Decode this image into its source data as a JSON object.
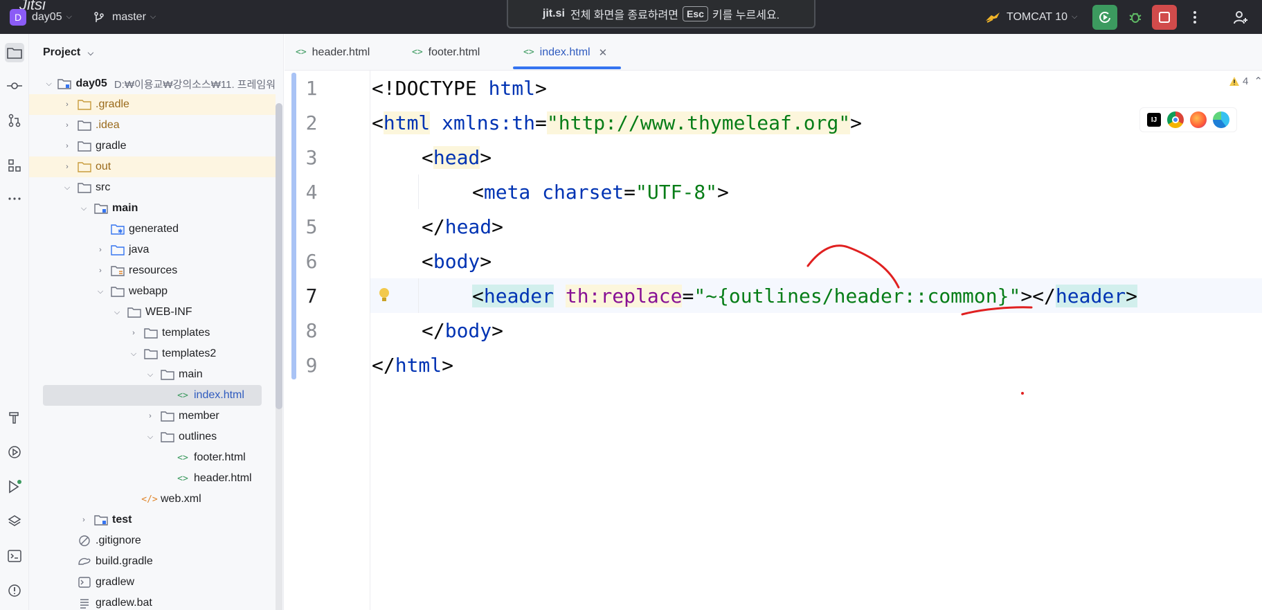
{
  "titlebar": {
    "app_logo_text": "Jitsi",
    "project_badge": "D",
    "project_name": "day05",
    "branch": "master",
    "banner_brand": "jit.si",
    "banner_text_before": "전체 화면을 종료하려면",
    "banner_key": "Esc",
    "banner_text_after": "키를 누르세요.",
    "run_config": "TOMCAT 10"
  },
  "project_panel": {
    "title": "Project",
    "root": {
      "name": "day05",
      "path": "D:₩이용교₩강의소스₩11. 프레임워"
    },
    "items": [
      {
        "label": ".gradle"
      },
      {
        "label": ".idea"
      },
      {
        "label": "gradle"
      },
      {
        "label": "out"
      },
      {
        "label": "src"
      },
      {
        "label": "main"
      },
      {
        "label": "generated"
      },
      {
        "label": "java"
      },
      {
        "label": "resources"
      },
      {
        "label": "webapp"
      },
      {
        "label": "WEB-INF"
      },
      {
        "label": "templates"
      },
      {
        "label": "templates2"
      },
      {
        "label": "main"
      },
      {
        "label": "index.html"
      },
      {
        "label": "member"
      },
      {
        "label": "outlines"
      },
      {
        "label": "footer.html"
      },
      {
        "label": "header.html"
      },
      {
        "label": "web.xml"
      },
      {
        "label": "test"
      },
      {
        "label": ".gitignore"
      },
      {
        "label": "build.gradle"
      },
      {
        "label": "gradlew"
      },
      {
        "label": "gradlew.bat"
      }
    ]
  },
  "tabs": [
    {
      "label": "header.html"
    },
    {
      "label": "footer.html"
    },
    {
      "label": "index.html"
    }
  ],
  "editor": {
    "line_numbers": [
      "1",
      "2",
      "3",
      "4",
      "5",
      "6",
      "7",
      "8",
      "9"
    ],
    "warning_count": "4",
    "lines": {
      "l1": {
        "a": "<!DOCTYPE ",
        "b": "html",
        "c": ">"
      },
      "l2": {
        "a": "<",
        "b": "html",
        "c": " ",
        "d": "xmlns:th",
        "e": "=",
        "f": "\"http://www.thymeleaf.org\"",
        "g": ">"
      },
      "l3": {
        "a": "<",
        "b": "head",
        "c": ">"
      },
      "l4": {
        "a": "<",
        "b": "meta",
        "c": " ",
        "d": "charset",
        "e": "=",
        "f": "\"UTF-8\"",
        "g": ">"
      },
      "l5": {
        "a": "</",
        "b": "head",
        "c": ">"
      },
      "l6": {
        "a": "<",
        "b": "body",
        "c": ">"
      },
      "l7": {
        "a": "<",
        "b": "header",
        "c": " ",
        "d": "th:replace",
        "e": "=",
        "f": "\"~{outlines/header::common}\"",
        "g": "></",
        "h": "header",
        "i": ">"
      },
      "l8": {
        "a": "</",
        "b": "body",
        "c": ">"
      },
      "l9": {
        "a": "</",
        "b": "html",
        "c": ">"
      }
    }
  },
  "colors": {
    "titlebar_bg": "#27282e",
    "accent_blue": "#3574f0",
    "run_green": "#3c9a5f",
    "stop_red": "#d14b4b",
    "annotation_red": "#e02020"
  }
}
